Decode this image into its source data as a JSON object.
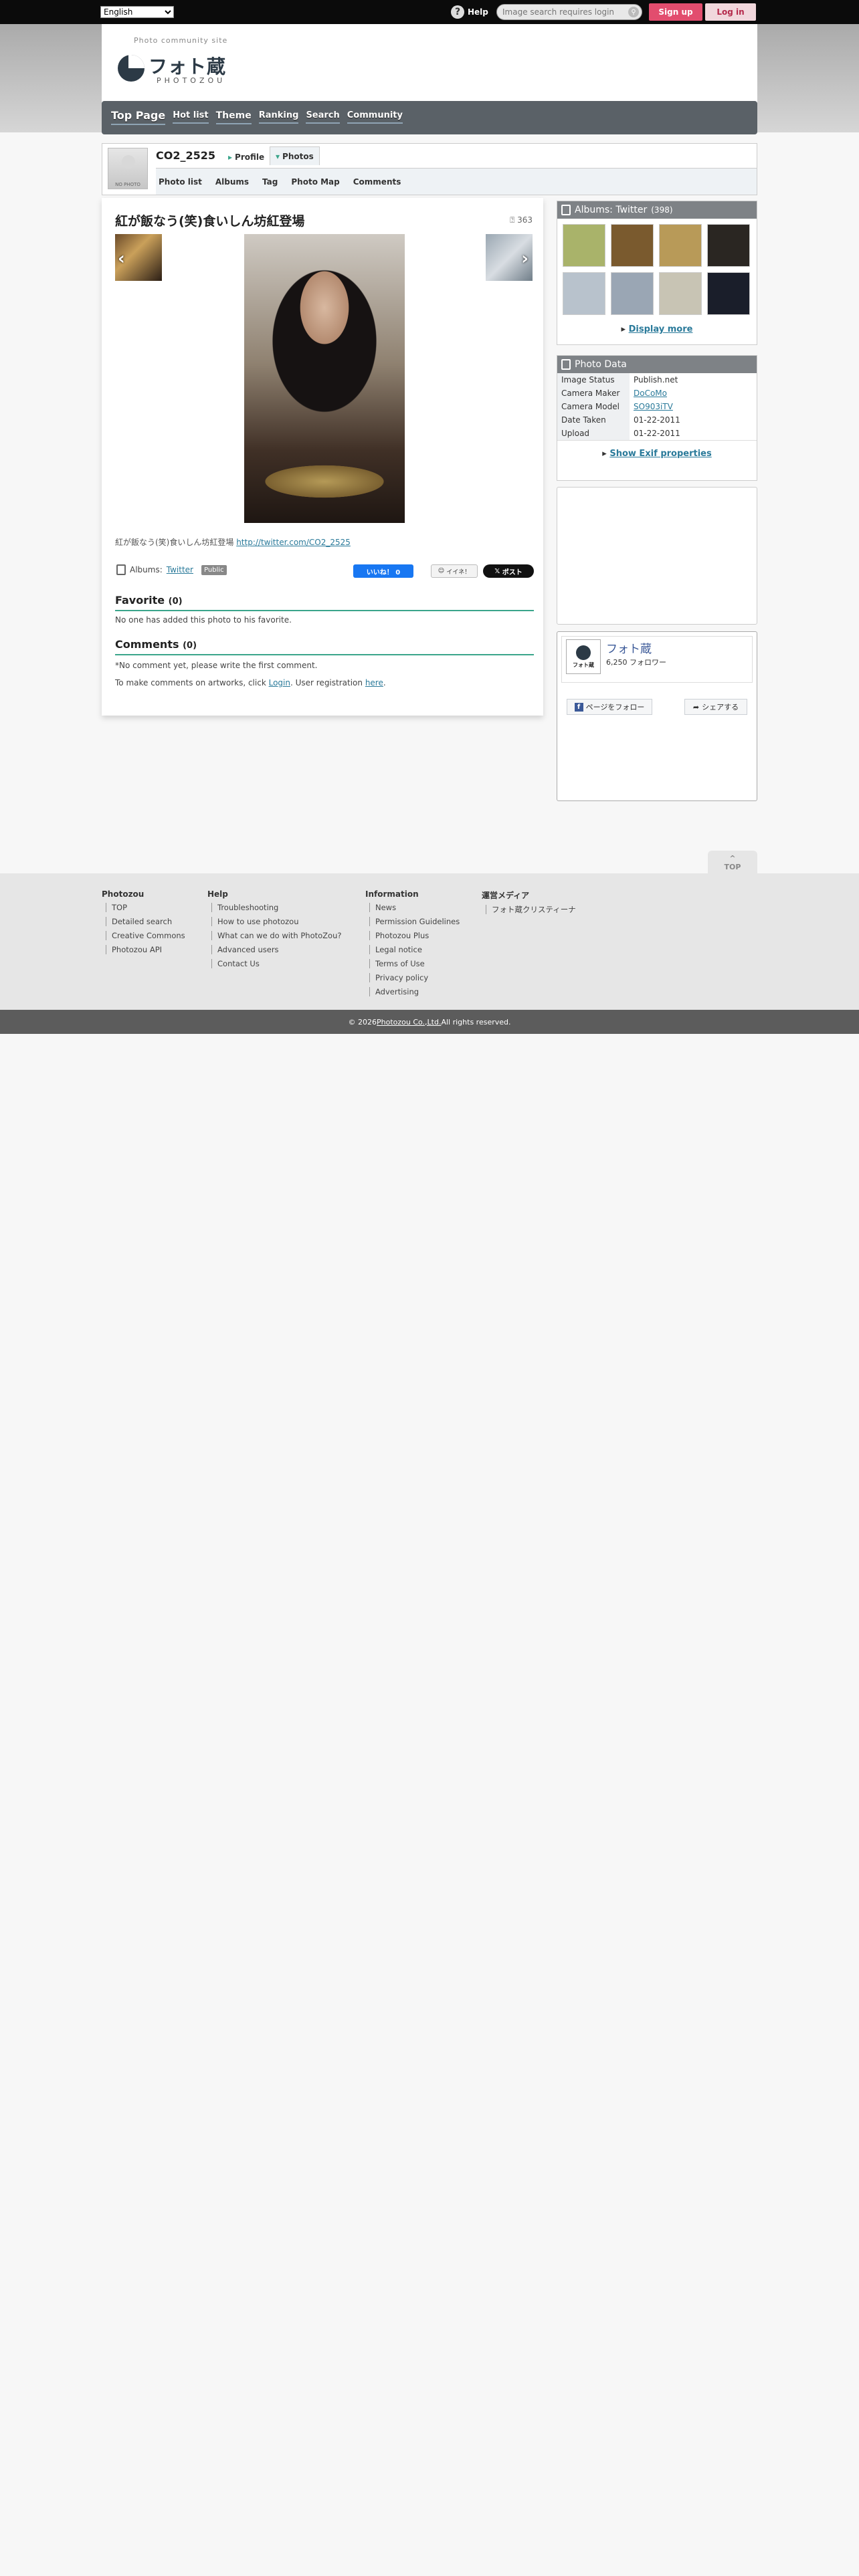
{
  "topbar": {
    "language": "English",
    "help_label": "Help",
    "search_placeholder": "Image search requires login",
    "signup_label": "Sign up",
    "login_label": "Log in"
  },
  "header": {
    "tagline": "Photo community site",
    "logo_text": "フォト蔵",
    "logo_sub": "PHOTOZOU"
  },
  "mainnav": [
    "Top Page",
    "Hot list",
    "Theme",
    "Ranking",
    "Search",
    "Community"
  ],
  "profile": {
    "avatar_text": "NO PHOTO",
    "username": "CO2_2525",
    "tab_profile": "Profile",
    "tab_photos": "Photos",
    "subnav": [
      "Photo list",
      "Albums",
      "Tag",
      "Photo Map",
      "Comments"
    ]
  },
  "photo": {
    "title": "紅が飯なう(笑)食いしん坊紅登場",
    "views": "363",
    "description_text": "紅が飯なう(笑)食いしん坊紅登場 ",
    "description_link": "http://twitter.com/CO2_2525",
    "albums_label": "Albums:",
    "album_name": "Twitter",
    "public_badge": "Public",
    "like_label": "いいね！ 0",
    "iine_label": "イイネ！",
    "post_label": "ポスト"
  },
  "favorite": {
    "title": "Favorite",
    "count": "(0)",
    "empty_text": "No one has added this photo to his favorite."
  },
  "comments": {
    "title": "Comments",
    "count": "(0)",
    "empty_text": "*No comment yet, please write the first comment.",
    "login_prefix": "To make comments on artworks, click ",
    "login_link": "Login",
    "login_middle": ". User registration ",
    "here_link": "here",
    "login_suffix": "."
  },
  "albums_side": {
    "title": "Albums: Twitter",
    "count": "(398)",
    "display_more": "Display more",
    "thumb_colors": [
      "#a9b36a",
      "#7a5a2e",
      "#b89a58",
      "#2a2622",
      "#b8c2cc",
      "#9aa6b4",
      "#c8c4b4",
      "#1a1e2a"
    ]
  },
  "photodata": {
    "title": "Photo Data",
    "rows": [
      {
        "key": "Image Status",
        "value": "Publish.net"
      },
      {
        "key": "Camera Maker",
        "value": "DoCoMo",
        "link": true
      },
      {
        "key": "Camera Model",
        "value": "SO903iTV",
        "link": true
      },
      {
        "key": "Date Taken",
        "value": "01-22-2011"
      },
      {
        "key": "Upload",
        "value": "01-22-2011"
      }
    ],
    "exif_link": "Show Exif properties"
  },
  "facebook": {
    "logo_text": "フォト蔵",
    "page_name": "フォト蔵",
    "followers": "6,250 フォロワー",
    "follow_label": "ページをフォロー",
    "share_label": "シェアする"
  },
  "footer": {
    "top_label": "TOP",
    "columns": [
      {
        "title": "Photozou",
        "items": [
          "TOP",
          "Detailed search",
          "Creative Commons",
          "Photozou API"
        ]
      },
      {
        "title": "Help",
        "items": [
          "Troubleshooting",
          "How to use photozou",
          "What can we do with PhotoZou?",
          "Advanced users",
          "Contact Us"
        ]
      },
      {
        "title": "Information",
        "items": [
          "News",
          "Permission Guidelines",
          "Photozou Plus",
          "Legal notice",
          "Terms of Use",
          "Privacy policy",
          "Advertising"
        ]
      },
      {
        "title": "運営メディア",
        "items": [
          "フォト蔵クリスティーナ"
        ]
      }
    ],
    "copyright_prefix": "© 2026 ",
    "copyright_link": "Photozou Co.,Ltd.",
    "copyright_suffix": " All rights reserved."
  }
}
